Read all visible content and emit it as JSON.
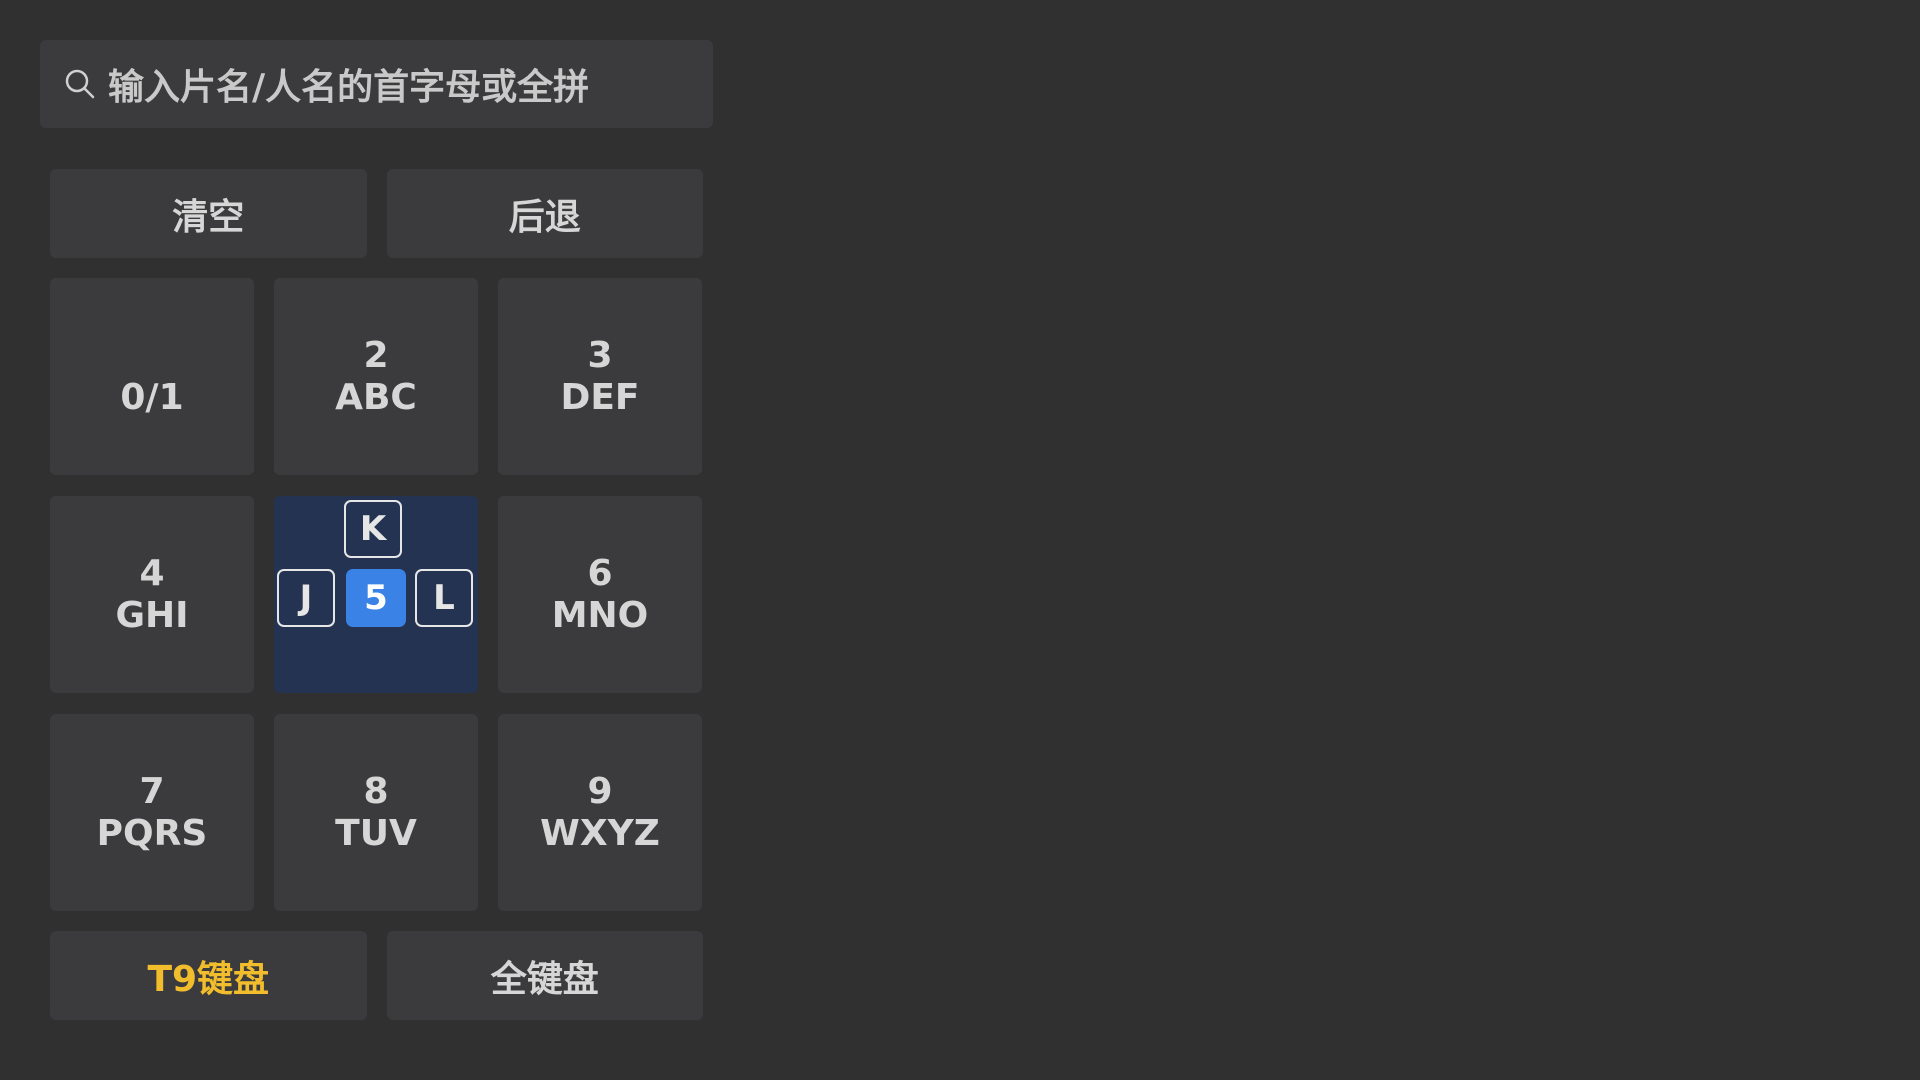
{
  "search": {
    "placeholder": "输入片名/人名的首字母或全拼",
    "icon": "search-icon"
  },
  "actions": {
    "clear_label": "清空",
    "backspace_label": "后退"
  },
  "keys": [
    {
      "num": "",
      "letters": "0/1"
    },
    {
      "num": "2",
      "letters": "ABC"
    },
    {
      "num": "3",
      "letters": "DEF"
    },
    {
      "num": "4",
      "letters": "GHI"
    },
    {
      "num": "5",
      "letters": "JKL",
      "expanded": {
        "top": "K",
        "left": "J",
        "center": "5",
        "right": "L"
      }
    },
    {
      "num": "6",
      "letters": "MNO"
    },
    {
      "num": "7",
      "letters": "PQRS"
    },
    {
      "num": "8",
      "letters": "TUV"
    },
    {
      "num": "9",
      "letters": "WXYZ"
    }
  ],
  "keyboard_modes": {
    "t9_label": "T9键盘",
    "full_label": "全键盘",
    "selected": "t9"
  },
  "colors": {
    "background": "#303030",
    "key": "#3b3b3d",
    "active_key": "#243352",
    "focus": "#3a82e6",
    "selected_mode": "#f2bd2c"
  }
}
